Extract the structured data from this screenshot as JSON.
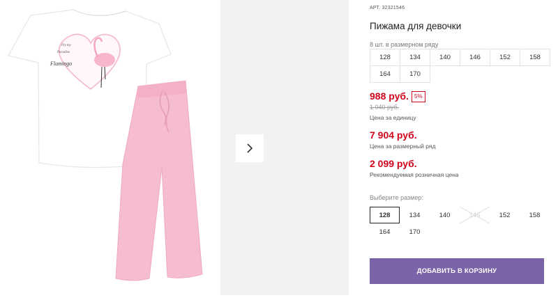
{
  "product": {
    "art_label": "АРТ.",
    "art_number": "32321546",
    "title": "Пижама для девочки",
    "image_print_text": [
      "Fly my",
      "Paradise",
      "Flamingo"
    ]
  },
  "size_row": {
    "note": "8 шт. в размерном ряду",
    "sizes": [
      "128",
      "134",
      "140",
      "146",
      "152",
      "158",
      "164",
      "170"
    ]
  },
  "pricing": {
    "unit_price": "988 руб.",
    "discount": "5%",
    "old_price": "1 040 руб.",
    "unit_note": "Цена за единицу",
    "row_price": "7 904 руб.",
    "row_note": "Цена за размерный ряд",
    "retail_price": "2 099 руб.",
    "retail_note": "Рекомендуемая розничная цена"
  },
  "size_select": {
    "label": "Выберите размер:",
    "selected": "128",
    "unavailable": "146",
    "options": [
      "128",
      "134",
      "140",
      "146",
      "152",
      "158",
      "164",
      "170"
    ]
  },
  "actions": {
    "add_to_cart": "ДОБАВИТЬ В КОРЗИНУ"
  },
  "colors": {
    "price": "#d0021b",
    "button": "#7a63a6",
    "pants": "#f6bcd0",
    "thumb_bg": "#f2f2f2"
  },
  "icons": {
    "next": "chevron-right-icon"
  }
}
